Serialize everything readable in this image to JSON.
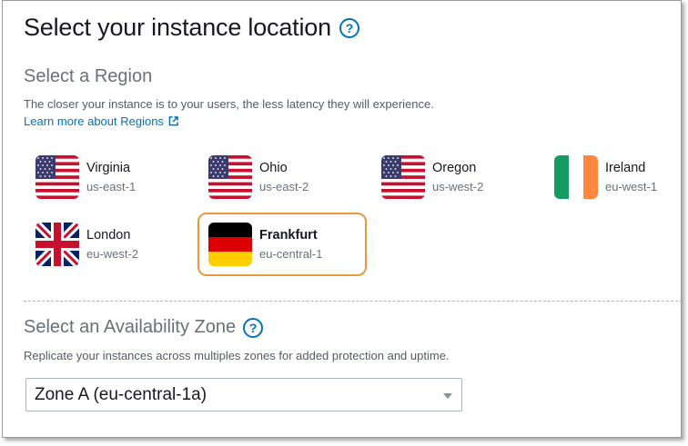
{
  "header": {
    "title": "Select your instance location",
    "help": "?"
  },
  "region_section": {
    "title": "Select a Region",
    "description": "The closer your instance is to your users, the less latency they will experience.",
    "learn_more": "Learn more about Regions"
  },
  "regions": [
    {
      "name": "Virginia",
      "code": "us-east-1",
      "flag": "us-flag",
      "selected": false
    },
    {
      "name": "Ohio",
      "code": "us-east-2",
      "flag": "us-flag",
      "selected": false
    },
    {
      "name": "Oregon",
      "code": "us-west-2",
      "flag": "us-flag",
      "selected": false
    },
    {
      "name": "Ireland",
      "code": "eu-west-1",
      "flag": "ireland-flag",
      "selected": false
    },
    {
      "name": "London",
      "code": "eu-west-2",
      "flag": "uk-flag",
      "selected": false
    },
    {
      "name": "Frankfurt",
      "code": "eu-central-1",
      "flag": "germany-flag",
      "selected": true
    }
  ],
  "zone_section": {
    "title": "Select an Availability Zone",
    "help": "?",
    "description": "Replicate your instances across multiples zones for added protection and uptime.",
    "selected_zone": "Zone A (eu-central-1a)"
  },
  "colors": {
    "link": "#0073bb",
    "selected_border": "#e69a3a"
  }
}
